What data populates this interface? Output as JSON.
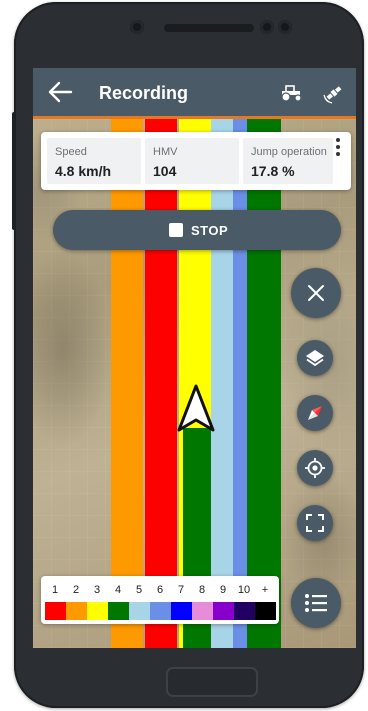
{
  "appbar": {
    "title": "Recording",
    "back_icon": "arrow-left-icon",
    "vehicle_icon": "tractor-icon",
    "gps_icon": "satellite-icon"
  },
  "info": [
    {
      "label": "Speed",
      "value": "4.8 km/h"
    },
    {
      "label": "HMV",
      "value": "104"
    },
    {
      "label": "Jump operation",
      "value": "17.8 %"
    }
  ],
  "stop_button": {
    "label": "STOP"
  },
  "side_buttons": [
    "close-icon",
    "layers-icon",
    "compass-icon",
    "gps-locate-icon",
    "fullscreen-icon"
  ],
  "legend": {
    "labels": [
      "1",
      "2",
      "3",
      "4",
      "5",
      "6",
      "7",
      "8",
      "9",
      "10",
      "+"
    ],
    "colors": [
      "#ff0000",
      "#ff9900",
      "#ffff00",
      "#007700",
      "#a8d4e8",
      "#6b8fe6",
      "#0000ff",
      "#e68cd8",
      "#8800cc",
      "#200060",
      "#000000"
    ]
  },
  "map_stripe_colors": [
    "#ff9900",
    "#ff0000",
    "#ffff00",
    "#007700",
    "#a8d4e8",
    "#6b8fe6",
    "#007700"
  ],
  "accent_color": "#e87722",
  "bar_color": "#4a5a66"
}
